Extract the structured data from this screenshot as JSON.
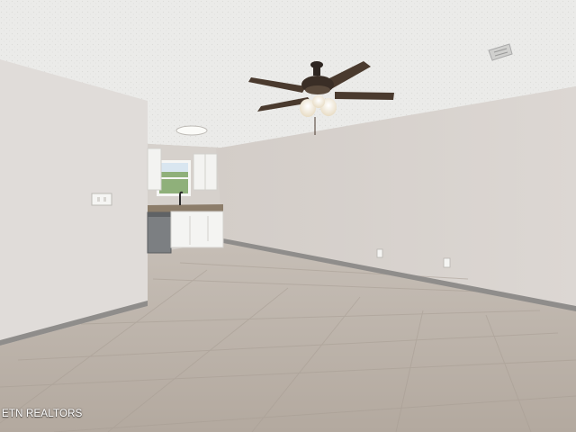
{
  "photo": {
    "subject": "empty-living-room-with-kitchen",
    "watermark": "ETN REALTORS"
  },
  "colors": {
    "ceiling": "#e9e9e7",
    "left_wall": "#dfdcda",
    "right_wall": "#d8d3cf",
    "back_wall": "#d4cfca",
    "floor": "#bcb3aa",
    "baseboard": "#8e8c8a",
    "cabinet": "#f3f3f1",
    "countertop": "#8c7d6a",
    "fan_blade": "#4a3a2e",
    "fan_light": "#f7f2e6"
  }
}
